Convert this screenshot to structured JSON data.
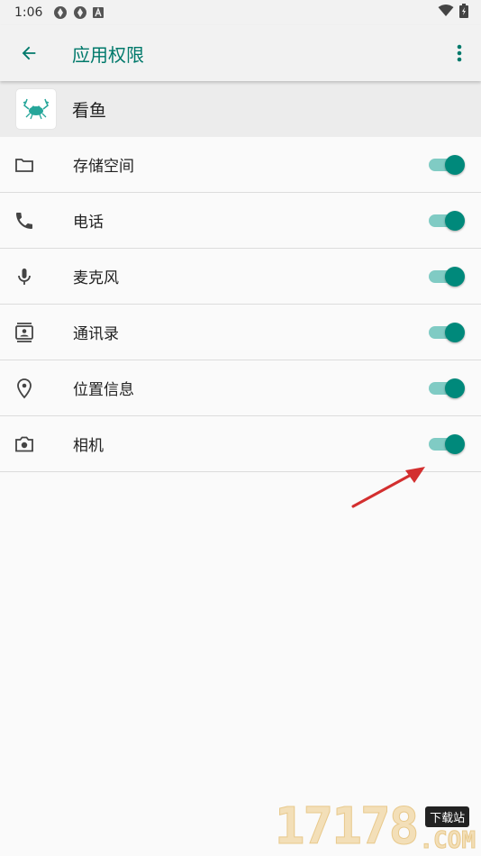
{
  "status_bar": {
    "time": "1:06",
    "left_icons": [
      "app-notification-icon",
      "app-notification-icon",
      "a-badge-icon"
    ],
    "right_icons": [
      "wifi-icon",
      "battery-icon"
    ]
  },
  "app_bar": {
    "title": "应用权限",
    "back_icon": "arrow-back-icon",
    "more_icon": "more-vert-icon",
    "accent": "#00796b"
  },
  "app": {
    "name": "看鱼",
    "icon": "crab-app-icon"
  },
  "permissions": [
    {
      "label": "存储空间",
      "icon": "folder-icon",
      "enabled": true
    },
    {
      "label": "电话",
      "icon": "phone-icon",
      "enabled": true
    },
    {
      "label": "麦克风",
      "icon": "mic-icon",
      "enabled": true
    },
    {
      "label": "通讯录",
      "icon": "contacts-icon",
      "enabled": true
    },
    {
      "label": "位置信息",
      "icon": "location-icon",
      "enabled": true
    },
    {
      "label": "相机",
      "icon": "camera-icon",
      "enabled": true
    }
  ],
  "switch_colors": {
    "thumb": "#00897b",
    "track": "#80cbc4"
  },
  "annotation": {
    "arrow_color": "#d32f2f"
  },
  "watermark": {
    "number": "17178",
    "tag": "下载站",
    "suffix": ".COM"
  }
}
